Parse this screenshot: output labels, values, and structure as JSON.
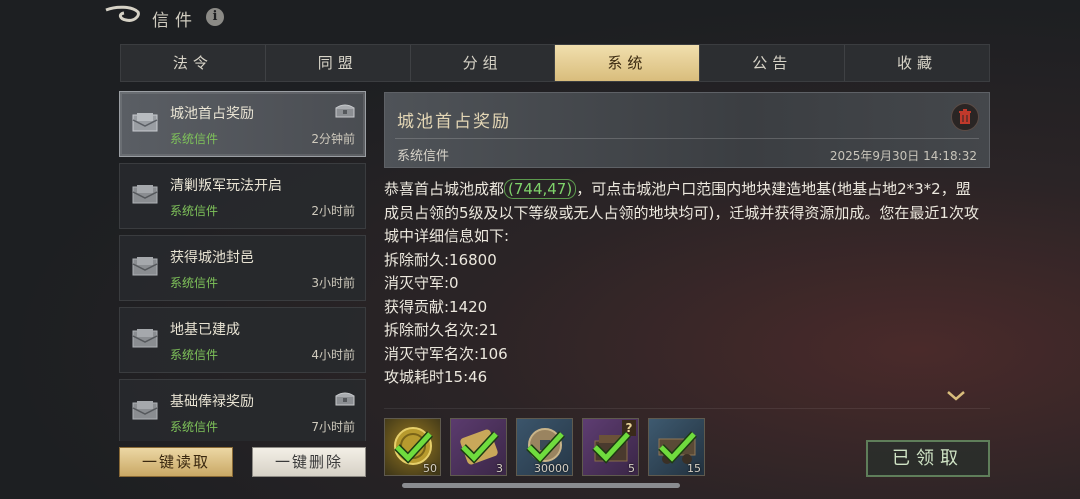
{
  "header": {
    "title": "信件",
    "info_icon": "i"
  },
  "tabs": [
    {
      "label": "法令",
      "active": false
    },
    {
      "label": "同盟",
      "active": false
    },
    {
      "label": "分组",
      "active": false
    },
    {
      "label": "系统",
      "active": true
    },
    {
      "label": "公告",
      "active": false
    },
    {
      "label": "收藏",
      "active": false
    }
  ],
  "mails": [
    {
      "title": "城池首占奖励",
      "sub": "系统信件",
      "time": "2分钟前",
      "has_attachment": true,
      "selected": true
    },
    {
      "title": "清剿叛军玩法开启",
      "sub": "系统信件",
      "time": "2小时前",
      "has_attachment": false
    },
    {
      "title": "获得城池封邑",
      "sub": "系统信件",
      "time": "3小时前",
      "has_attachment": false
    },
    {
      "title": "地基已建成",
      "sub": "系统信件",
      "time": "4小时前",
      "has_attachment": false
    },
    {
      "title": "基础俸禄奖励",
      "sub": "系统信件",
      "time": "7小时前",
      "has_attachment": true
    }
  ],
  "buttons": {
    "read_all": "一键读取",
    "delete_all": "一键删除",
    "claimed": "已领取"
  },
  "detail": {
    "title": "城池首占奖励",
    "type": "系统信件",
    "date": "2025年9月30日 14:18:32",
    "intro_before": "恭喜首占城池成都",
    "coord": "(744,47)",
    "intro_after": "，可点击城池户口范围内地块建造地基(地基占地2*3*2，盟成员占领的5级及以下等级或无人占领的地块均可)，迁城并获得资源加成。您在最近1次攻城中详细信息如下:",
    "lines": [
      "拆除耐久:16800",
      "消灭守军:0",
      "获得贡献:1420",
      "拆除耐久名次:21",
      "消灭守军名次:106",
      "攻城耗时15:46"
    ]
  },
  "rewards": [
    {
      "icon": "gold-coin-icon",
      "qty": "50",
      "claimed": true
    },
    {
      "icon": "scroll-icon",
      "qty": "3",
      "claimed": true
    },
    {
      "icon": "copper-coin-icon",
      "qty": "30000",
      "claimed": true
    },
    {
      "icon": "mystery-box-icon",
      "qty": "5",
      "claimed": true,
      "question": "?"
    },
    {
      "icon": "siege-cart-icon",
      "qty": "15",
      "claimed": true
    }
  ],
  "colors": {
    "accent_gold": "#d9bd7c",
    "green_text": "#7fc35a"
  }
}
